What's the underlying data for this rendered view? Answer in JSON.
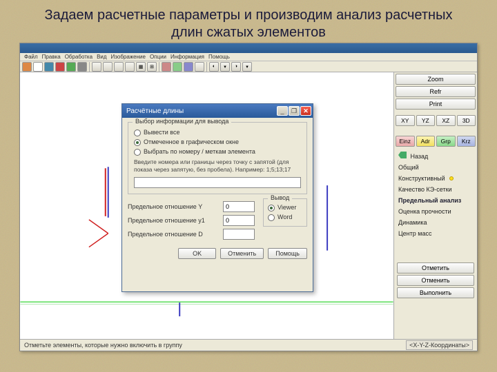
{
  "slide_title": "Задаем расчетные параметры и производим анализ расчетных длин сжатых элементов",
  "menu": [
    "Файл",
    "Правка",
    "Обработка",
    "Вид",
    "Изображение",
    "Опции",
    "Информация",
    "Помощь"
  ],
  "right": {
    "zoom": "Zoom",
    "refr": "Refr",
    "print": "Print",
    "views": [
      "XY",
      "YZ",
      "XZ",
      "3D"
    ],
    "modes": {
      "einz": "Einz",
      "adr": "Adr",
      "grp": "Grp",
      "krz": "Krz"
    },
    "nav_back": "Назад",
    "items": [
      "Общий",
      "Конструктивный",
      "Качество КЭ-сетки",
      "Предельный анализ",
      "Оценка прочности",
      "Динамика",
      "Центр масс"
    ],
    "active_index": 3,
    "btn_mark": "Отметить",
    "btn_cancel": "Отменить",
    "btn_exec": "Выполнить"
  },
  "status": {
    "left": "Отметьте элементы, которые нужно включить в группу",
    "right": "<X-Y-Z-Координаты>"
  },
  "dialog": {
    "title": "Расчётные длины",
    "group1_title": "Выбор информации для вывода",
    "opt_all": "Вывести все",
    "opt_marked": "Отмеченное в графическом окне",
    "opt_bynum": "Выбрать по номеру / меткам элемента",
    "hint": "Введите номера или границы через точку с запятой (для показа через запятую, без пробела). Например: 1;5;13;17",
    "lbl_y": "Предельное отношение Y",
    "lbl_y2": "Предельное отношение y1",
    "lbl_d": "Предельное отношение D",
    "val_y": "0",
    "val_y2": "0",
    "val_d": "",
    "out_title": "Вывод",
    "out_viewer": "Viewer",
    "out_word": "Word",
    "btn_ok": "OK",
    "btn_cancel": "Отменить",
    "btn_help": "Помощь"
  }
}
